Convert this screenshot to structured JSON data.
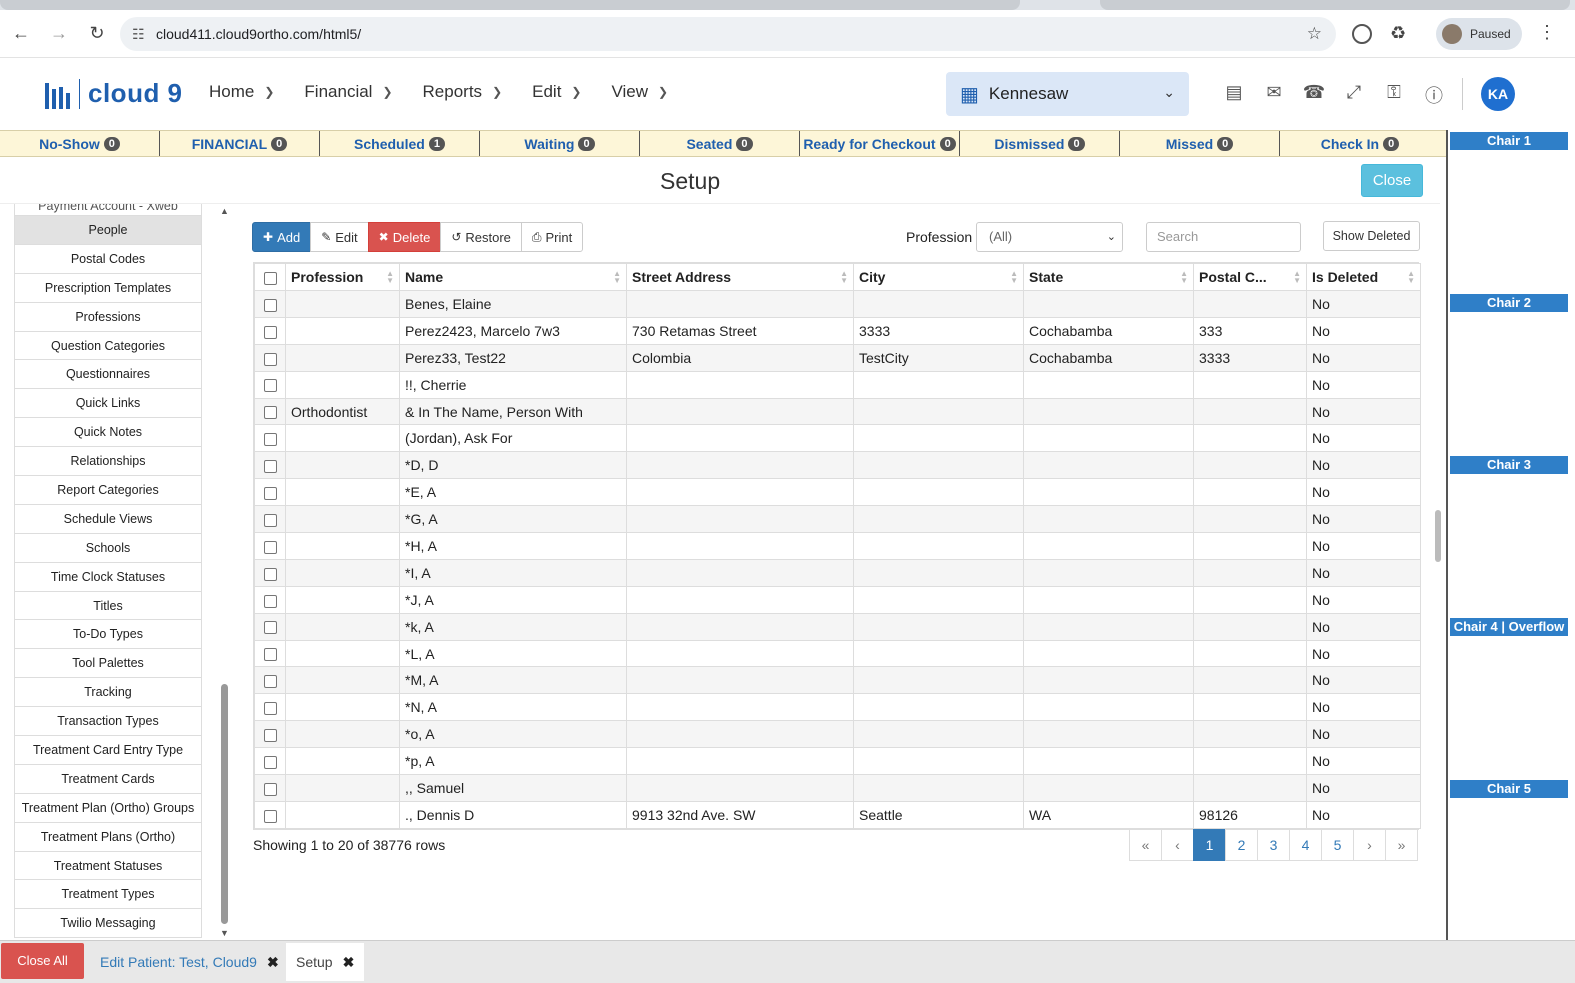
{
  "browser": {
    "url": "cloud411.cloud9ortho.com/html5/",
    "profile_label": "Paused"
  },
  "app": {
    "logo_text": "cloud 9",
    "menu": [
      {
        "label": "Home"
      },
      {
        "label": "Financial"
      },
      {
        "label": "Reports"
      },
      {
        "label": "Edit"
      },
      {
        "label": "View"
      }
    ],
    "location": "Kennesaw",
    "user_initials": "KA"
  },
  "status_bar": [
    {
      "label": "No-Show",
      "count": "0"
    },
    {
      "label": "FINANCIAL",
      "count": "0"
    },
    {
      "label": "Scheduled",
      "count": "1"
    },
    {
      "label": "Waiting",
      "count": "0"
    },
    {
      "label": "Seated",
      "count": "0"
    },
    {
      "label": "Ready for Checkout",
      "count": "0"
    },
    {
      "label": "Dismissed",
      "count": "0"
    },
    {
      "label": "Missed",
      "count": "0"
    },
    {
      "label": "Check In",
      "count": "0"
    }
  ],
  "chairs": [
    "Chair 1",
    "Chair 2",
    "Chair 3",
    "Chair 4 | Overflow",
    "Chair 5"
  ],
  "setup": {
    "title": "Setup",
    "close_label": "Close"
  },
  "sidebar": {
    "partial_item": "Payment Account - Xweb",
    "items": [
      "People",
      "Postal Codes",
      "Prescription Templates",
      "Professions",
      "Question Categories",
      "Questionnaires",
      "Quick Links",
      "Quick Notes",
      "Relationships",
      "Report Categories",
      "Schedule Views",
      "Schools",
      "Time Clock Statuses",
      "Titles",
      "To-Do Types",
      "Tool Palettes",
      "Tracking",
      "Transaction Types",
      "Treatment Card Entry Type",
      "Treatment Cards",
      "Treatment Plan (Ortho) Groups",
      "Treatment Plans (Ortho)",
      "Treatment Statuses",
      "Treatment Types",
      "Twilio Messaging"
    ],
    "active": "People"
  },
  "toolbar": {
    "add": "Add",
    "edit": "Edit",
    "delete": "Delete",
    "restore": "Restore",
    "print": "Print",
    "profession_label": "Profession",
    "profession_value": "(All)",
    "search_placeholder": "Search",
    "show_deleted": "Show Deleted"
  },
  "table": {
    "columns": [
      "Profession",
      "Name",
      "Street Address",
      "City",
      "State",
      "Postal C...",
      "Is Deleted"
    ],
    "rows": [
      [
        "",
        "Benes, Elaine",
        "",
        "",
        "",
        "",
        "No"
      ],
      [
        "",
        "Perez2423, Marcelo 7w3",
        "730 Retamas Street",
        "3333",
        "Cochabamba",
        "333",
        "No"
      ],
      [
        "",
        "Perez33, Test22",
        "Colombia",
        "TestCity",
        "Cochabamba",
        "3333",
        "No"
      ],
      [
        "",
        "!!, Cherrie",
        "",
        "",
        "",
        "",
        "No"
      ],
      [
        "Orthodontist",
        "& In The Name, Person With",
        "",
        "",
        "",
        "",
        "No"
      ],
      [
        "",
        "(Jordan), Ask For",
        "",
        "",
        "",
        "",
        "No"
      ],
      [
        "",
        "*D, D",
        "",
        "",
        "",
        "",
        "No"
      ],
      [
        "",
        "*E, A",
        "",
        "",
        "",
        "",
        "No"
      ],
      [
        "",
        "*G, A",
        "",
        "",
        "",
        "",
        "No"
      ],
      [
        "",
        "*H, A",
        "",
        "",
        "",
        "",
        "No"
      ],
      [
        "",
        "*I, A",
        "",
        "",
        "",
        "",
        "No"
      ],
      [
        "",
        "*J, A",
        "",
        "",
        "",
        "",
        "No"
      ],
      [
        "",
        "*k, A",
        "",
        "",
        "",
        "",
        "No"
      ],
      [
        "",
        "*L, A",
        "",
        "",
        "",
        "",
        "No"
      ],
      [
        "",
        "*M, A",
        "",
        "",
        "",
        "",
        "No"
      ],
      [
        "",
        "*N, A",
        "",
        "",
        "",
        "",
        "No"
      ],
      [
        "",
        "*o, A",
        "",
        "",
        "",
        "",
        "No"
      ],
      [
        "",
        "*p, A",
        "",
        "",
        "",
        "",
        "No"
      ],
      [
        "",
        ",, Samuel",
        "",
        "",
        "",
        "",
        "No"
      ],
      [
        "",
        "., Dennis D",
        "9913 32nd Ave. SW",
        "Seattle",
        "WA",
        "98126",
        "No"
      ]
    ]
  },
  "footer": {
    "row_summary": "Showing 1 to 20 of 38776 rows",
    "pages": [
      "«",
      "‹",
      "1",
      "2",
      "3",
      "4",
      "5",
      "›",
      "»"
    ],
    "current_page": "1"
  },
  "bottom_tabs": {
    "close_all": "Close All",
    "tabs": [
      {
        "label": "Edit Patient: Test, Cloud9"
      },
      {
        "label": "Setup"
      }
    ]
  }
}
